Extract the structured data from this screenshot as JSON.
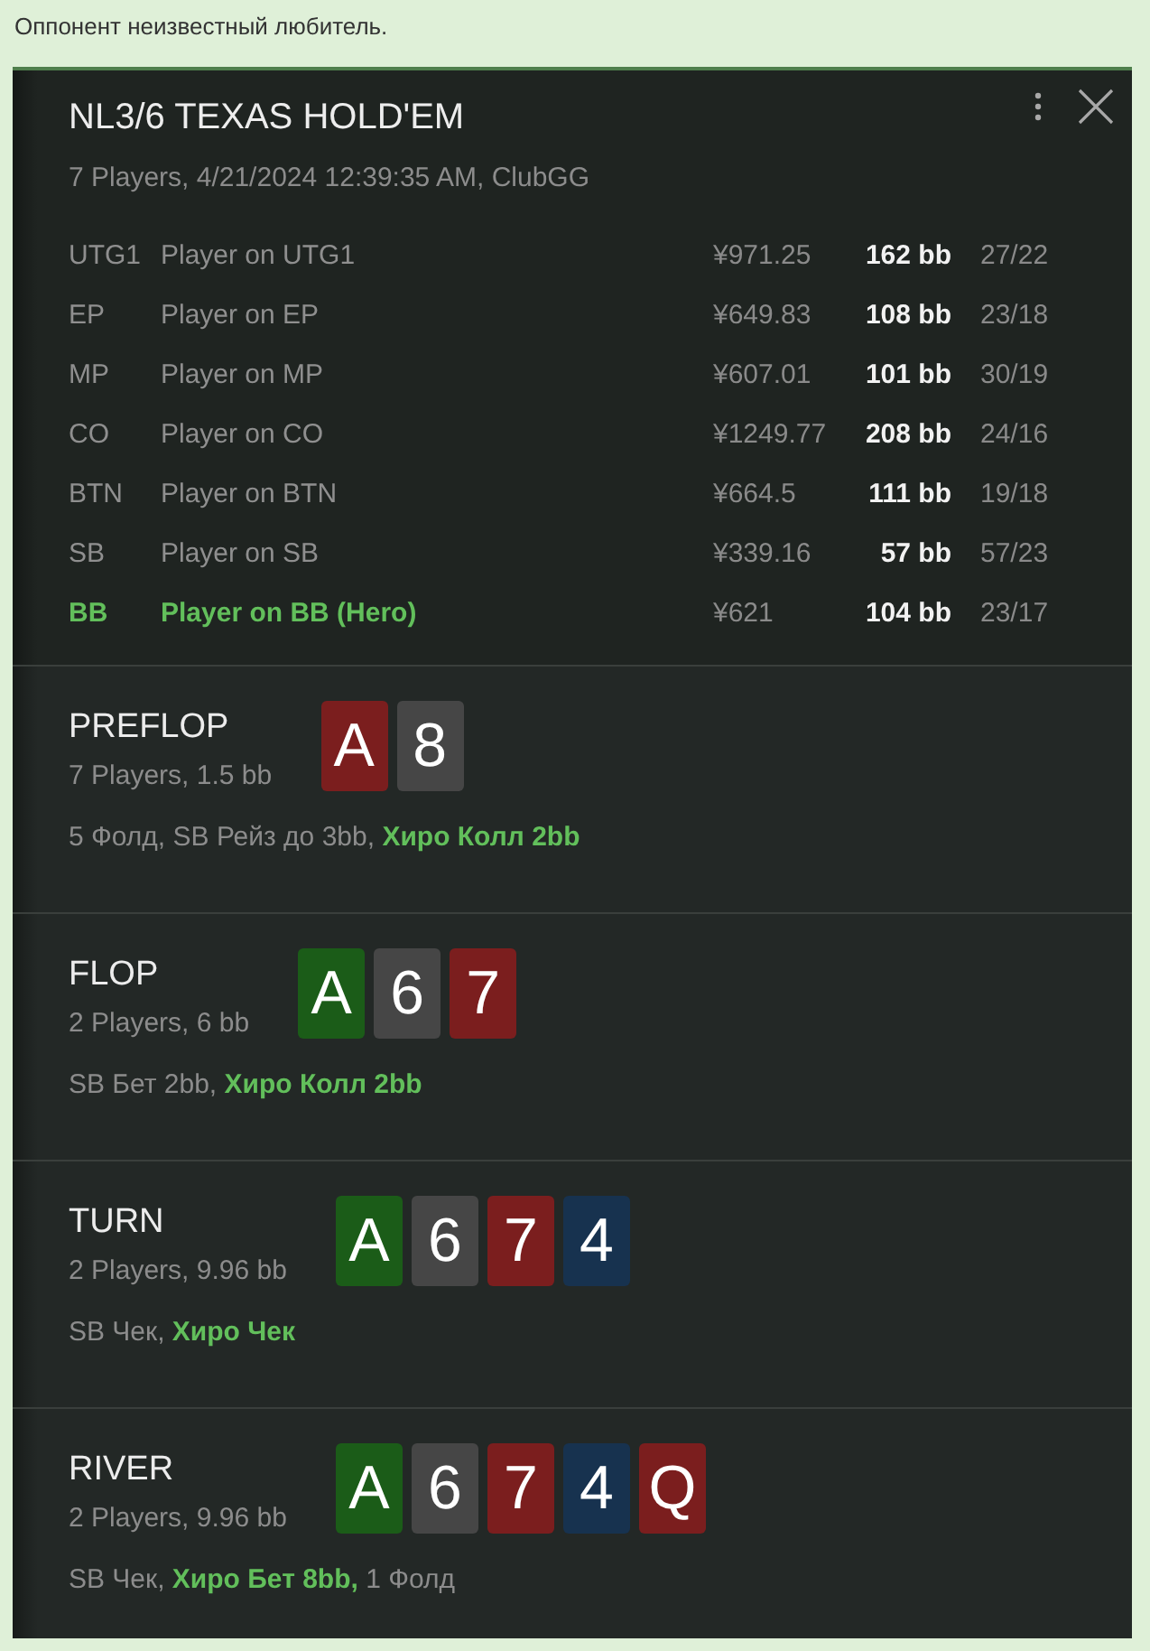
{
  "note": "Оппонент неизвестный любитель.",
  "hand": {
    "title": "NL3/6 TEXAS HOLD'EM",
    "info": "7 Players, 4/21/2024 12:39:35 AM, ClubGG"
  },
  "players": [
    {
      "position": "UTG1",
      "name": "Player on UTG1",
      "stack": "¥971.25",
      "stack_bb": "162 bb",
      "column_5": "27/22",
      "hero": false
    },
    {
      "position": "EP",
      "name": "Player on EP",
      "stack": "¥649.83",
      "stack_bb": "108 bb",
      "column_5": "23/18",
      "hero": false
    },
    {
      "position": "MP",
      "name": "Player on MP",
      "stack": "¥607.01",
      "stack_bb": "101 bb",
      "column_5": "30/19",
      "hero": false
    },
    {
      "position": "CO",
      "name": "Player on CO",
      "stack": "¥1249.77",
      "stack_bb": "208 bb",
      "column_5": "24/16",
      "hero": false
    },
    {
      "position": "BTN",
      "name": "Player on BTN",
      "stack": "¥664.5",
      "stack_bb": "111 bb",
      "column_5": "19/18",
      "hero": false
    },
    {
      "position": "SB",
      "name": "Player on SB",
      "stack": "¥339.16",
      "stack_bb": "57 bb",
      "column_5": "57/23",
      "hero": false
    },
    {
      "position": "BB",
      "name": "Player on BB (Hero)",
      "stack": "¥621",
      "stack_bb": "104 bb",
      "column_5": "23/17",
      "hero": true
    }
  ],
  "streets": [
    {
      "name": "PREFLOP",
      "info": "7 Players, 1.5 bb",
      "cards": [
        {
          "rank": "A",
          "color": "#7b1e1e"
        },
        {
          "rank": "8",
          "color": "#464646"
        }
      ],
      "actions": "5 Фолд, SB Рейз до 3bb, **Хиро Колл 2bb**"
    },
    {
      "name": "FLOP",
      "info": "2 Players, 6 bb",
      "cards": [
        {
          "rank": "A",
          "color": "#1b5c18"
        },
        {
          "rank": "6",
          "color": "#464646"
        },
        {
          "rank": "7",
          "color": "#7b1e1e"
        }
      ],
      "actions": "SB Бет 2bb, **Хиро Колл 2bb**"
    },
    {
      "name": "TURN",
      "info": "2 Players, 9.96 bb",
      "cards": [
        {
          "rank": "A",
          "color": "#1b5c18"
        },
        {
          "rank": "6",
          "color": "#464646"
        },
        {
          "rank": "7",
          "color": "#7b1e1e"
        },
        {
          "rank": "4",
          "color": "#17324f"
        }
      ],
      "actions": "SB Чек, **Хиро Чек**"
    },
    {
      "name": "RIVER",
      "info": "2 Players, 9.96 bb",
      "cards": [
        {
          "rank": "A",
          "color": "#1b5c18"
        },
        {
          "rank": "6",
          "color": "#464646"
        },
        {
          "rank": "7",
          "color": "#7b1e1e"
        },
        {
          "rank": "4",
          "color": "#17324f"
        },
        {
          "rank": "Q",
          "color": "#7b1e1e"
        }
      ],
      "actions": "SB Чек, **Хиро Бет 8bb,** 1 Фолд"
    }
  ]
}
